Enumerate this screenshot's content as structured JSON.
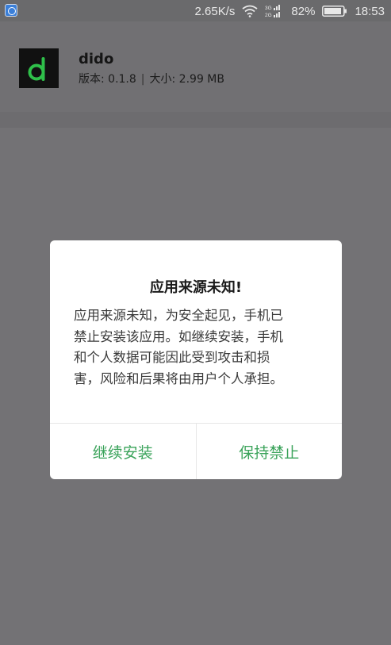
{
  "status_bar": {
    "network_speed": "2.65K/s",
    "battery_percent": "82%",
    "time": "18:53",
    "signal_labels": [
      "3G",
      "2G"
    ],
    "icons": [
      "app-notification-icon",
      "wifi-icon",
      "signal-icon",
      "battery-icon"
    ]
  },
  "app": {
    "name": "dido",
    "version_text": "版本: 0.1.8",
    "separator": "|",
    "size_text": "大小: 2.99 MB",
    "logo_letter": "d",
    "logo_color": "#2fc04a"
  },
  "dialog": {
    "title": "应用来源未知!",
    "body_lines": [
      "应用来源未知，为安全起见，手机已",
      "禁止安装该应用。如继续安装，手机",
      "和个人数据可能因此受到攻击和损",
      "害，风险和后果将由用户个人承担。"
    ],
    "continue_label": "继续安装",
    "keep_blocked_label": "保持禁止",
    "accent_color": "#3aa35a"
  }
}
